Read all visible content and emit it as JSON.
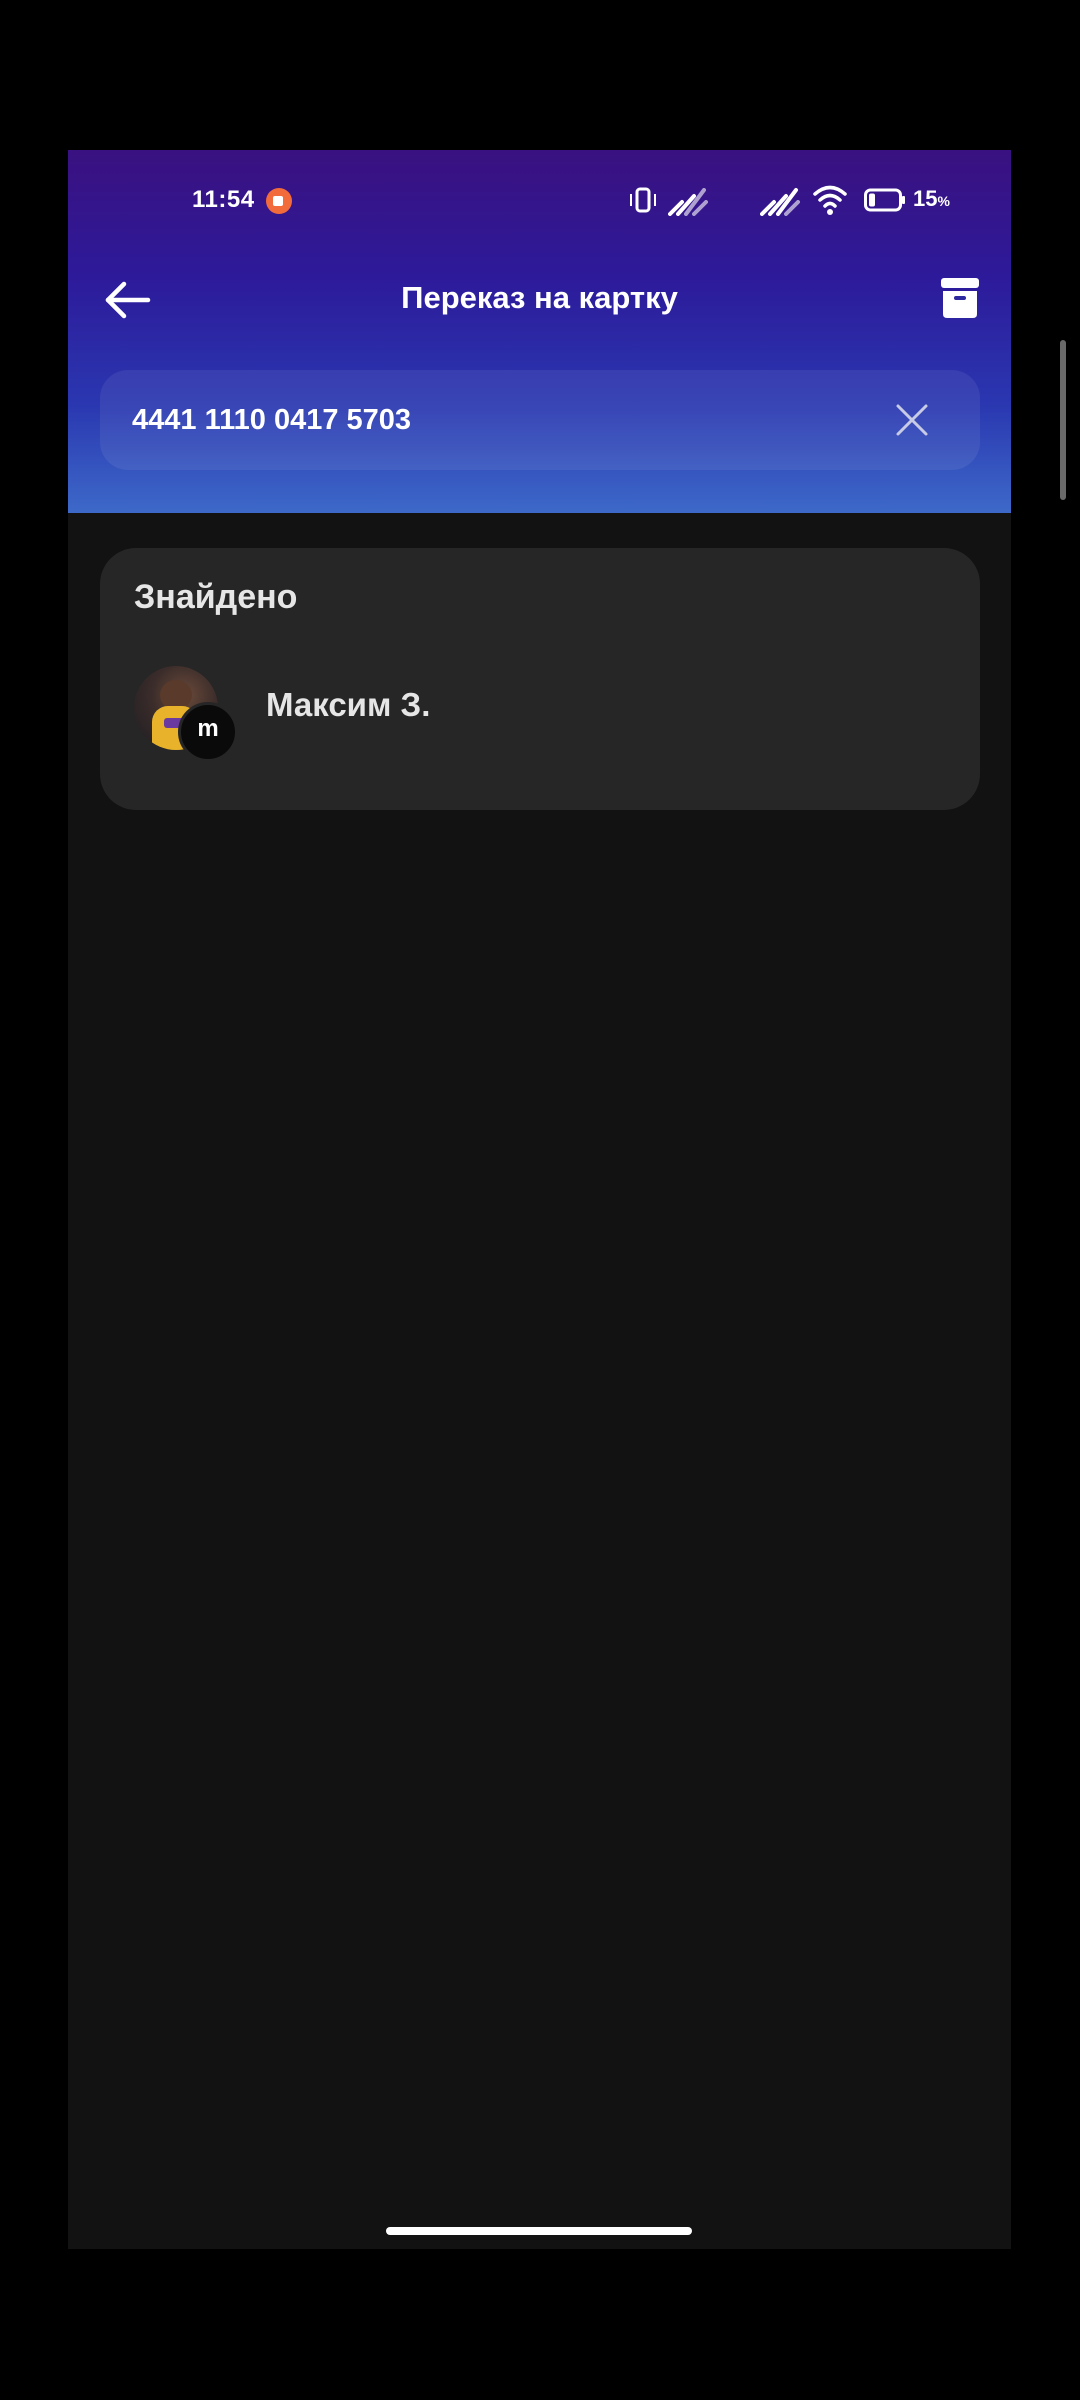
{
  "status_bar": {
    "time": "11:54",
    "battery_percent": "15",
    "battery_unit": "%",
    "icons": [
      "screen-record-icon",
      "vibrate-icon",
      "signal-icon",
      "signal-icon",
      "wifi-icon",
      "battery-icon"
    ]
  },
  "app_bar": {
    "title": "Переказ на картку",
    "back_icon": "arrow-left-icon",
    "archive_icon": "archive-box-icon"
  },
  "search": {
    "value": "4441 1110 0417 5703",
    "clear_icon": "close-icon"
  },
  "results": {
    "heading": "Знайдено",
    "contacts": [
      {
        "name": "Максим З.",
        "badge_text": "m"
      }
    ]
  },
  "colors": {
    "header_gradient_top": "#3a1180",
    "header_gradient_bottom": "#3d69c9",
    "background": "#121212",
    "card": "#262626",
    "text_primary": "#ffffff",
    "text_secondary": "#e6e6e6"
  }
}
